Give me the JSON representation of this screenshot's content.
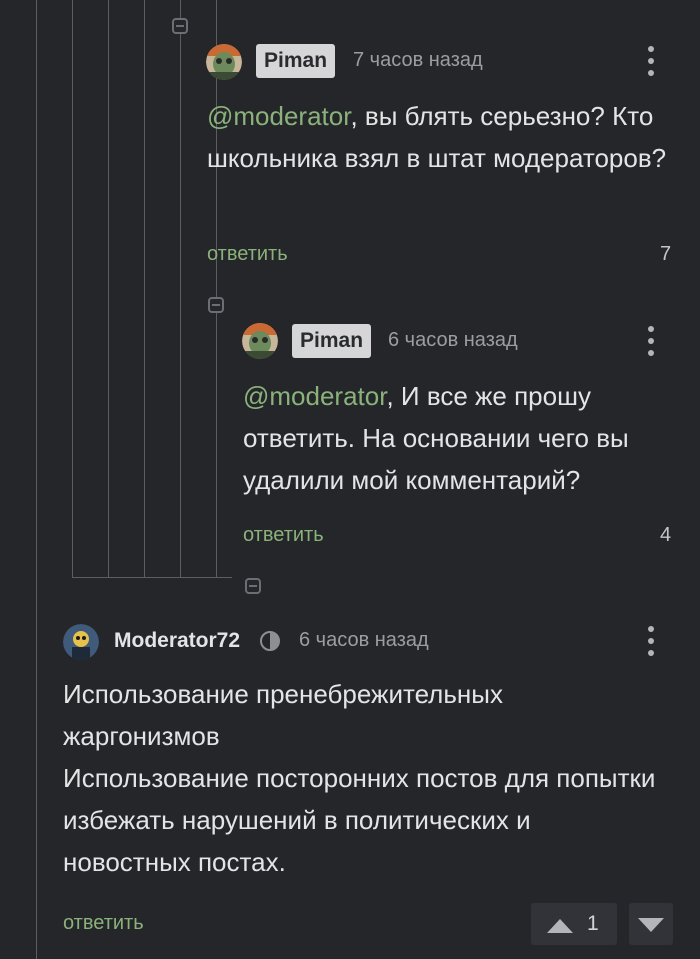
{
  "comments": [
    {
      "author": "Piman",
      "time": "7 часов назад",
      "mention": "@moderator",
      "text": ", вы блять серьезно? Кто школьника взял в штат модераторов?",
      "reply_label": "ответить",
      "rating": "7",
      "avatar_icon": "avatar-image"
    },
    {
      "author": "Piman",
      "time": "6 часов назад",
      "mention": "@moderator",
      "text": ", И все же прошу ответить. На основании чего вы удалили мой комментарий?",
      "reply_label": "ответить",
      "rating": "4",
      "avatar_icon": "avatar-image"
    },
    {
      "author": "Moderator72",
      "time": "6 часов назад",
      "text_line1": "Использование пренебрежительных жаргонизмов",
      "text_line2": "Использование посторонних постов для попытки избежать нарушений в политических и новостных постах.",
      "reply_label": "ответить",
      "rating": "1",
      "badge_icon": "moderator-badge-icon",
      "upvote_icon": "upvote-icon",
      "downvote_icon": "downvote-icon"
    }
  ],
  "colors": {
    "background": "#25262a",
    "accent_green": "#8ab27a",
    "badge_bg": "#d6d6d8",
    "muted_text": "#9c9da1"
  }
}
